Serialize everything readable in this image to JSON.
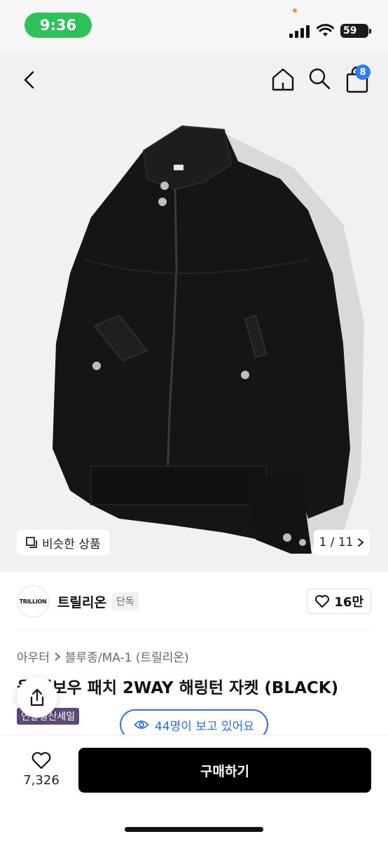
{
  "status_bar": {
    "time": "9:36",
    "battery": "59",
    "colors": {
      "time_pill": "#2fc159"
    }
  },
  "nav": {
    "back_icon": "chevron-left-icon",
    "home_icon": "home-icon",
    "search_icon": "search-icon",
    "bag_icon": "shopping-bag-icon",
    "cart_count": "8",
    "badge_color": "#2d7bf6"
  },
  "image": {
    "similar_label": "비슷한 상품",
    "pager": "1 / 11"
  },
  "brand": {
    "logo_text": "TRILLION",
    "name": "트릴리온",
    "tag": "단독",
    "likes": "16만"
  },
  "product": {
    "breadcrumb": [
      "아우터",
      "블루종/MA-1 (트릴리온)"
    ],
    "title": "울 레보우 패치 2WAY 해링턴 자켓 (BLACK)",
    "sale_badge": "연말결산세일",
    "viewers": "44명이 보고 있어요"
  },
  "bottom": {
    "heart_count": "7,326",
    "buy_label": "구매하기"
  }
}
